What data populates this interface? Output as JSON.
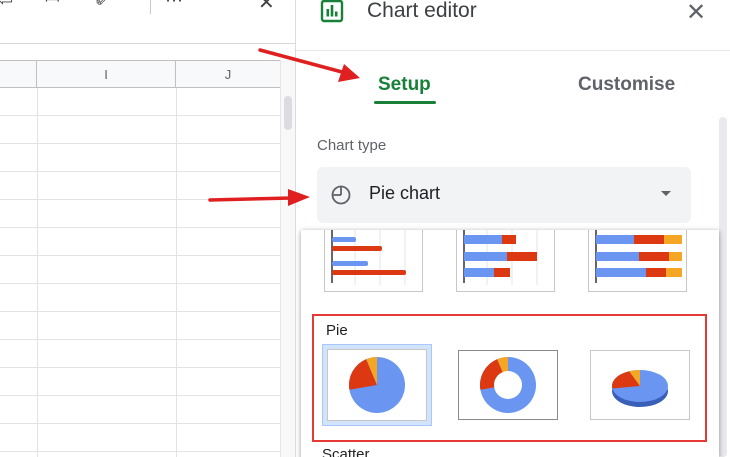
{
  "sheet": {
    "columns": [
      "I",
      "J"
    ],
    "toolbar_icons": [
      "undo-icon",
      "format-painter-icon",
      "insert-icon",
      "close-icon"
    ]
  },
  "editor": {
    "title": "Chart editor",
    "close_icon": "close-icon",
    "tabs": [
      {
        "label": "Setup",
        "active": true
      },
      {
        "label": "Customise",
        "active": false
      }
    ],
    "chart_type": {
      "label": "Chart type",
      "value": "Pie chart",
      "icon": "pie-chart-icon"
    },
    "dropdown": {
      "sections": [
        {
          "name": "",
          "options": [
            "bar-chart-thumbnail",
            "stacked-bar-chart-thumbnail",
            "100-stacked-bar-chart-thumbnail"
          ]
        },
        {
          "name": "Pie",
          "options": [
            "pie-chart-thumbnail",
            "doughnut-chart-thumbnail",
            "3d-pie-chart-thumbnail"
          ],
          "selected": 0
        },
        {
          "name": "Scatter",
          "options": []
        }
      ]
    }
  },
  "colors": {
    "accent_green": "#188038",
    "highlight_red": "#e53935",
    "arrow_red": "#e02020",
    "pie_blue": "#6a96f1",
    "pie_red": "#dc3912",
    "pie_orange": "#f5a623"
  }
}
